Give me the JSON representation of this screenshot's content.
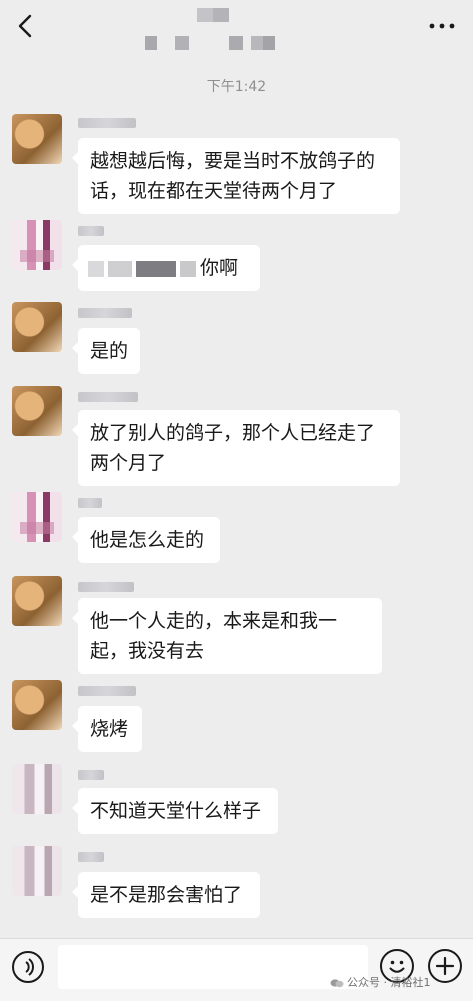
{
  "header": {
    "back_icon": "chevron-left-icon",
    "more_icon": "more-dots-icon",
    "more_label": "···"
  },
  "timestamp": "下午1:42",
  "messages": [
    {
      "avatar": "warm",
      "text": "越想越后悔，要是当时不放鸽子的话，现在都在天堂待两个月了"
    },
    {
      "avatar": "pink",
      "text": "你啊"
    },
    {
      "avatar": "warm",
      "text": "是的"
    },
    {
      "avatar": "warm",
      "text": "放了别人的鸽子，那个人已经走了两个月了"
    },
    {
      "avatar": "pink",
      "text": "他是怎么走的"
    },
    {
      "avatar": "warm",
      "text": "他一个人走的，本来是和我一起，我没有去"
    },
    {
      "avatar": "warm",
      "text": "烧烤"
    },
    {
      "avatar": "gray",
      "text": "不知道天堂什么样子"
    },
    {
      "avatar": "gray",
      "text": "是不是那会害怕了"
    }
  ],
  "input_bar": {
    "voice_icon": "voice-icon",
    "emoji_icon": "emoji-icon",
    "plus_icon": "plus-icon",
    "input_value": ""
  },
  "watermark": "公众号 · 清裕社1"
}
